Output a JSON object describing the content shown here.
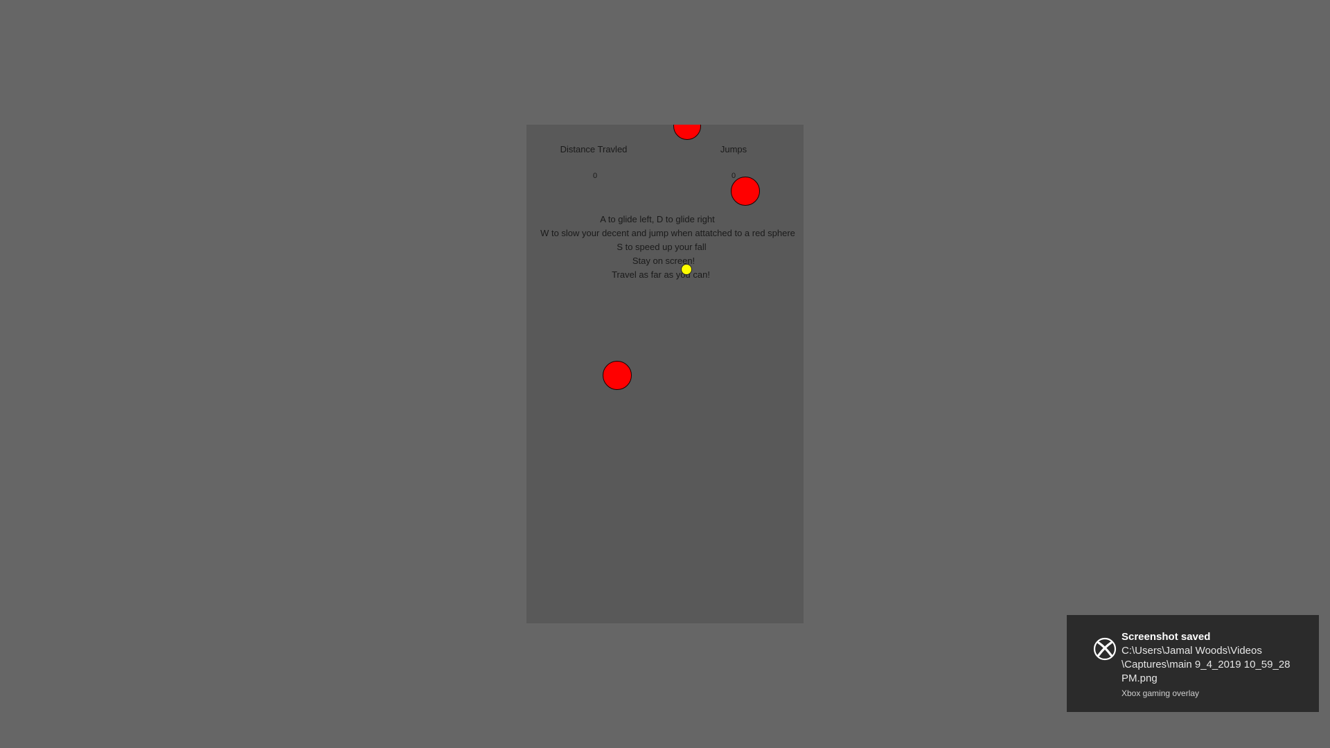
{
  "hud": {
    "distance_label": "Distance Travled",
    "distance_value": "0",
    "jumps_label": "Jumps",
    "jumps_value": "0"
  },
  "instructions": [
    "A to glide left, D to glide right",
    "W to slow your decent and jump when attatched to a red sphere",
    "S to speed up your fall",
    "Stay on screen!",
    "Travel as far as you can!"
  ],
  "colors": {
    "background": "#666666",
    "game_area": "#595959",
    "sphere": "#ff0000",
    "player": "#ffff00",
    "toast": "#2b2b2b"
  },
  "toast": {
    "icon": "xbox-icon",
    "title": "Screenshot saved",
    "path_lines": [
      "C:\\Users\\Jamal Woods\\Videos",
      "\\Captures\\main 9_4_2019 10_59_28",
      "PM.png"
    ],
    "source": "Xbox gaming overlay"
  }
}
